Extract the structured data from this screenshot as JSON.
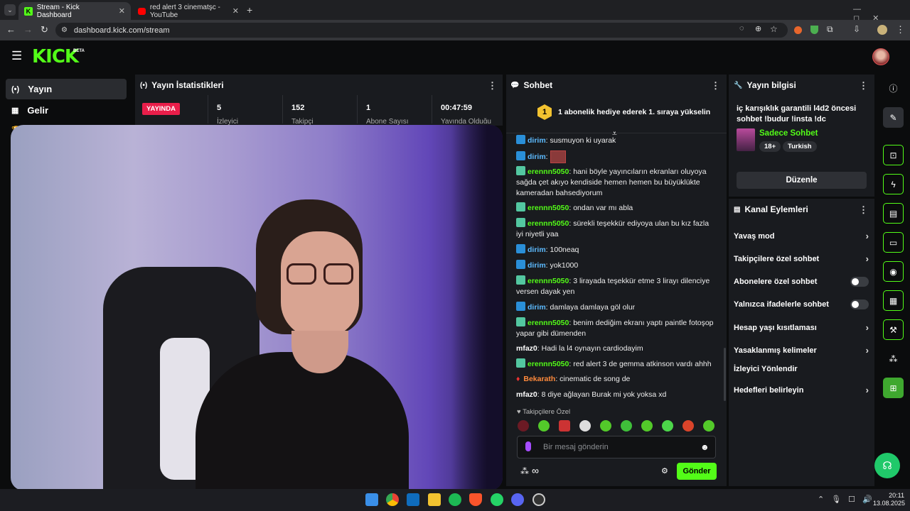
{
  "browser": {
    "tabs": [
      {
        "title": "Stream - Kick Dashboard",
        "active": true
      },
      {
        "title": "red alert 3 cinematşc - YouTube",
        "active": false
      }
    ],
    "url": "dashboard.kick.com/stream"
  },
  "header": {
    "logo": "KICK",
    "beta": "BETA"
  },
  "sidebar": {
    "items": [
      {
        "label": "Yayın",
        "icon": "broadcast-icon"
      },
      {
        "label": "Gelir",
        "icon": "chart-icon"
      }
    ]
  },
  "stats": {
    "title": "Yayın İstatistikleri",
    "live_badge": "YAYINDA",
    "cells": [
      {
        "value": "5",
        "label": "İzleyici"
      },
      {
        "value": "152",
        "label": "Takipçi"
      },
      {
        "value": "1",
        "label": "Abone Sayısı"
      },
      {
        "value": "00:47:59",
        "label": "Yayında Olduğu"
      }
    ]
  },
  "chat": {
    "title": "Sohbet",
    "pinned": {
      "badge": "1",
      "text": "1 abonelik hediye ederek 1. sıraya yükselin"
    },
    "messages": [
      {
        "user": "dirim",
        "text": "susmuyon ki uyarak"
      },
      {
        "user": "dirim",
        "text": ""
      },
      {
        "user": "erennn5050",
        "text": "hani böyle yayıncıların ekranları oluyoya sağda çet akıyo kendiside hemen hemen bu büyüklükte kameradan bahsediyorum"
      },
      {
        "user": "erennn5050",
        "text": "ondan var mı abla"
      },
      {
        "user": "erennn5050",
        "text": "sürekli teşekkür ediyoya ulan bu kız fazla iyi niyetli yaa"
      },
      {
        "user": "dirim",
        "text": "100neaq"
      },
      {
        "user": "dirim",
        "text": "yok1000"
      },
      {
        "user": "erennn5050",
        "text": "3 lirayada teşekkür etme 3 lirayı dilenciye versen dayak yen"
      },
      {
        "user": "dirim",
        "text": "damlaya damlaya göl olur"
      },
      {
        "user": "erennn5050",
        "text": "benim dediğim ekranı yaptı paintle fotoşop yapar gibi dümenden"
      },
      {
        "user": "mfaz0",
        "text": "Hadi la l4 oynayın cardiodayim"
      },
      {
        "user": "erennn5050",
        "text": "red alert 3 de gemma atkinson vardı ahhh"
      },
      {
        "user": "Bekarath",
        "text": "cinematic de song de"
      },
      {
        "user": "mfaz0",
        "text": "8 diye ağlayan Burak mi yok yoksa xd"
      }
    ],
    "followers_only": "Takipçilere Özel",
    "input_placeholder": "Bir mesaj gönderin",
    "send": "Gönder"
  },
  "stream_info": {
    "title": "Yayın bilgisi",
    "stream_title": "iç karışıklık garantili l4d2 öncesi sohbet !budur !insta !dc",
    "category": "Sadece Sohbet",
    "tags": [
      "18+",
      "Turkish"
    ],
    "edit": "Düzenle"
  },
  "channel_actions": {
    "title": "Kanal Eylemleri",
    "items": [
      {
        "label": "Yavaş mod",
        "control": "chevron"
      },
      {
        "label": "Takipçilere özel sohbet",
        "control": "chevron"
      },
      {
        "label": "Abonelere özel sohbet",
        "control": "toggle"
      },
      {
        "label": "Yalnızca ifadelerle sohbet",
        "control": "toggle"
      },
      {
        "label": "Hesap yaşı kısıtlaması",
        "control": "chevron"
      },
      {
        "label": "Yasaklanmış kelimeler",
        "control": "chevron"
      },
      {
        "label": "İzleyici Yönlendir",
        "control": "none"
      },
      {
        "label": "Hedefleri belirleyin",
        "control": "chevron"
      }
    ]
  },
  "taskbar": {
    "time": "20:11",
    "date": "13.08.2025"
  },
  "colors": {
    "accent": "#53fc18",
    "live": "#e91e4a",
    "panel": "#191b1f"
  }
}
